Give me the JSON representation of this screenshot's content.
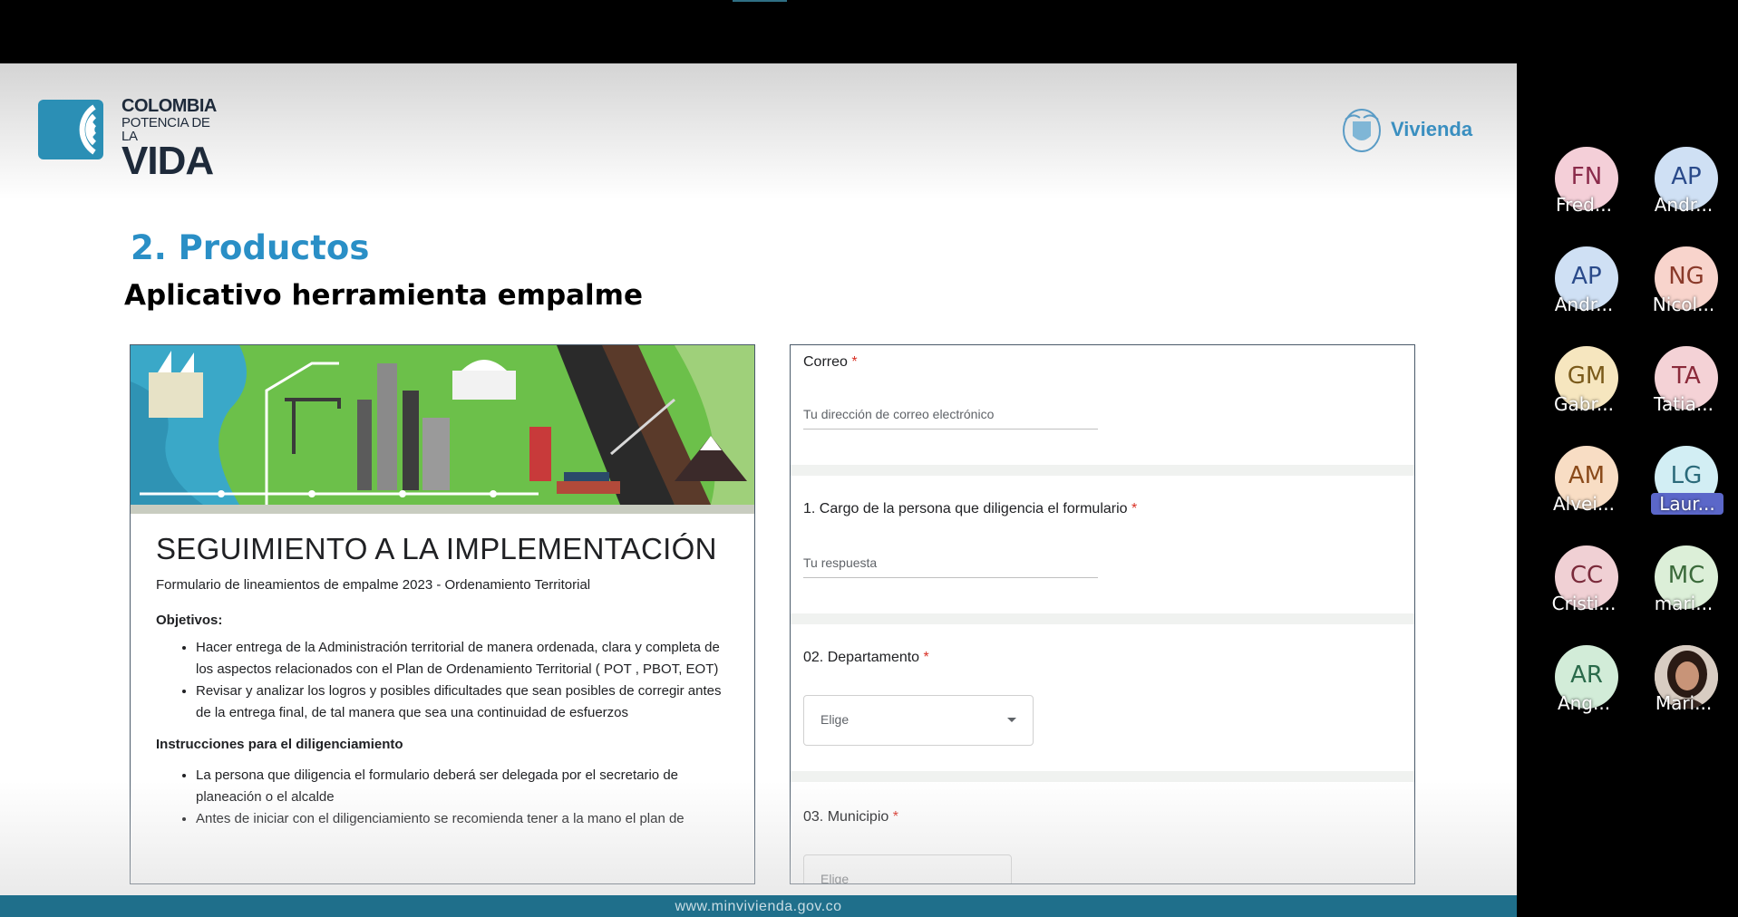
{
  "slide": {
    "logo_left": {
      "line1": "COLOMBIA",
      "line2": "POTENCIA DE LA",
      "line3": "VIDA"
    },
    "logo_right": {
      "name": "Vivienda"
    },
    "section_title": "2. Productos",
    "section_subtitle": "Aplicativo herramienta empalme",
    "footer_url": "www.minvivienda.gov.co"
  },
  "form_intro": {
    "title": "SEGUIMIENTO A LA IMPLEMENTACIÓN",
    "subtitle": "Formulario de lineamientos de empalme 2023 - Ordenamiento Territorial",
    "objectives_label": "Objetivos:",
    "objectives": [
      "Hacer entrega de la Administración territorial de manera ordenada, clara y completa de los aspectos relacionados  con el Plan de Ordenamiento Territorial  ( POT , PBOT, EOT)",
      "Revisar y analizar los logros y posibles dificultades que sean posibles de corregir antes de la entrega final, de tal manera que sea una continuidad de esfuerzos"
    ],
    "instructions_label": "Instrucciones para el diligenciamiento",
    "instructions": [
      "La persona que diligencia el formulario deberá ser delegada por el secretario de planeación o el alcalde",
      "Antes de iniciar con el diligenciamiento se recomienda tener a la mano el plan de"
    ]
  },
  "form_questions": {
    "email": {
      "label": "Correo",
      "required_mark": "*",
      "placeholder": "Tu dirección de correo electrónico"
    },
    "q1": {
      "label": "1. Cargo de la persona que diligencia el formulario",
      "required_mark": "*",
      "placeholder": "Tu respuesta"
    },
    "q2": {
      "label": "02. Departamento",
      "required_mark": "*",
      "select_value": "Elige"
    },
    "q3": {
      "label": "03. Municipio",
      "required_mark": "*",
      "select_value": "Elige"
    }
  },
  "participants": [
    {
      "initials": "FN",
      "name": "Fred...",
      "bg": "#f4cfd8",
      "fg": "#8a2a4a"
    },
    {
      "initials": "AP",
      "name": "Andr...",
      "bg": "#cfe0f4",
      "fg": "#2a4a8a"
    },
    {
      "initials": "AP",
      "name": "Andr...",
      "bg": "#cfe0f4",
      "fg": "#2a4a8a"
    },
    {
      "initials": "NG",
      "name": "Nicol...",
      "bg": "#f8d4cc",
      "fg": "#8a3a2a"
    },
    {
      "initials": "GM",
      "name": "Gabr...",
      "bg": "#f6e6bf",
      "fg": "#7a5a1a"
    },
    {
      "initials": "TA",
      "name": "Tatia...",
      "bg": "#f4d2d6",
      "fg": "#8a2a3a"
    },
    {
      "initials": "AM",
      "name": "Alvei...",
      "bg": "#f8ddc4",
      "fg": "#8a4a1a"
    },
    {
      "initials": "LG",
      "name": "Laur...",
      "bg": "#d2eef4",
      "fg": "#2a6a7a",
      "active": true
    },
    {
      "initials": "CC",
      "name": "Cristi...",
      "bg": "#f0d0d4",
      "fg": "#7a2a3a"
    },
    {
      "initials": "MC",
      "name": "mari...",
      "bg": "#dcefd8",
      "fg": "#3a6a3a"
    },
    {
      "initials": "AR",
      "name": "Ang...",
      "bg": "#d2ecd8",
      "fg": "#2a6a4a"
    },
    {
      "initials": "",
      "name": "Mari...",
      "bg": "#c8b6a6",
      "fg": "#000000",
      "photo": true
    }
  ],
  "colors": {
    "accent": "#2a8fc6",
    "footer": "#1f6f8b",
    "required": "#d93025",
    "active_name": "#5b67c9"
  }
}
